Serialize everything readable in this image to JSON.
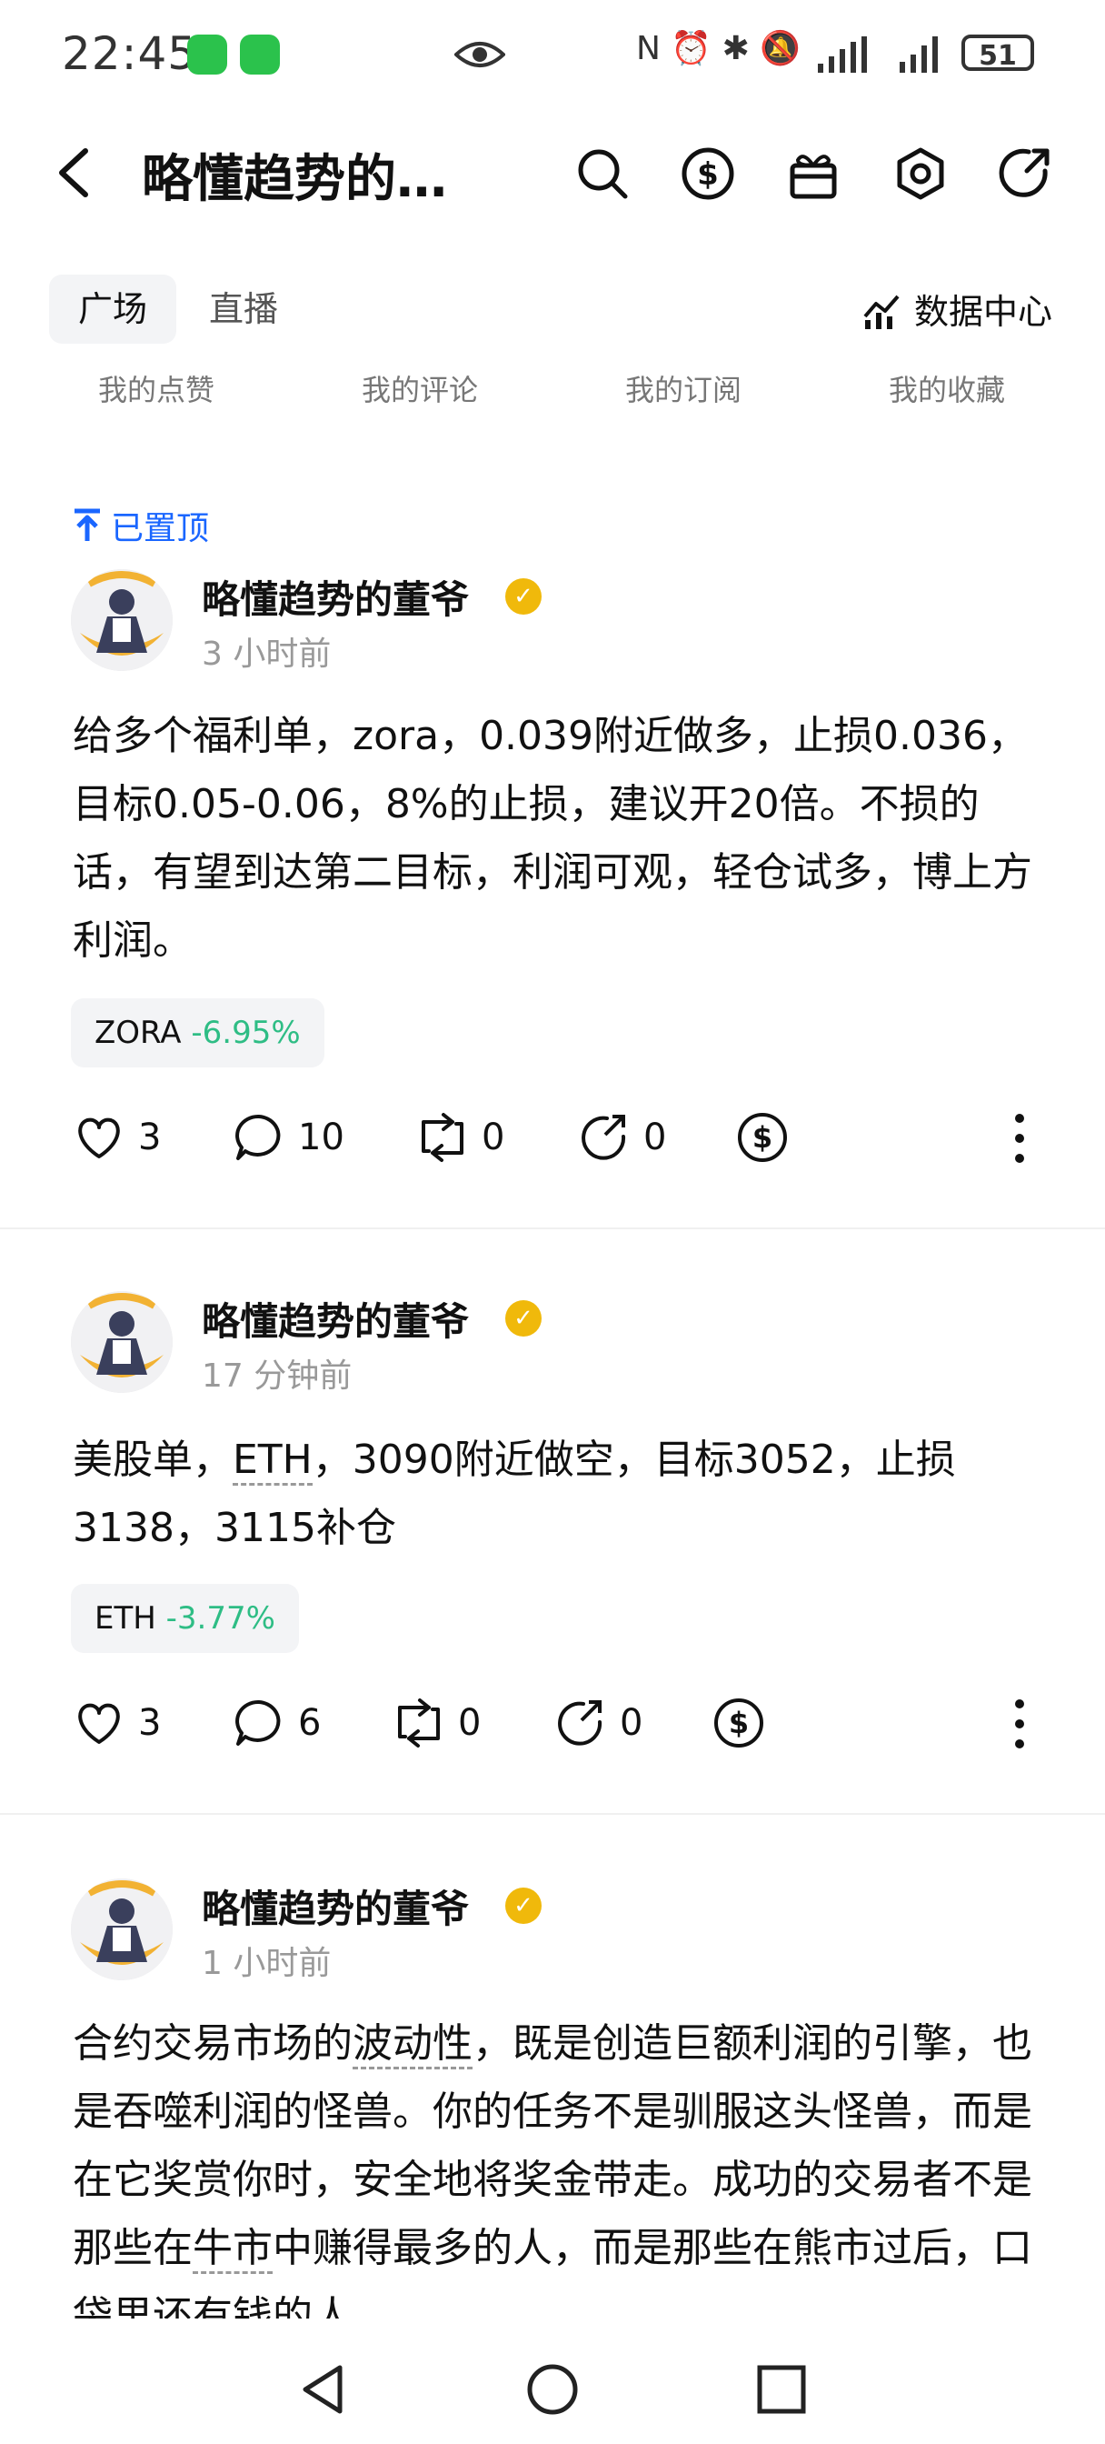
{
  "status_bar": {
    "time": "22:45",
    "signal_text": "N  ⏰  ✱  🔕",
    "battery": "51"
  },
  "header": {
    "title": "略懂趋势的…",
    "icons": [
      "search-icon",
      "dollar-icon",
      "gift-icon",
      "settings-icon",
      "share-icon"
    ]
  },
  "tabs": {
    "active": "广场",
    "other": "直播",
    "data_center": "数据中心"
  },
  "subtabs": [
    "我的点赞",
    "我的评论",
    "我的订阅",
    "我的收藏"
  ],
  "pinned_label": "已置顶",
  "posts": [
    {
      "author": "略懂趋势的董爷",
      "time": "3 小时前",
      "content": "给多个福利单，zora，0.039附近做多，止损0.036，目标0.05-0.06，8%的止损，建议开20倍。不损的话，有望到达第二目标，利润可观，轻仓试多，博上方利润。",
      "tag_symbol": "ZORA",
      "tag_change": "-6.95%",
      "likes": "3",
      "comments": "10",
      "reposts": "0",
      "shares": "0"
    },
    {
      "author": "略懂趋势的董爷",
      "time": "17 分钟前",
      "content_parts": [
        "美股单，",
        "ETH",
        "，3090附近做空，目标3052，止损3138，3115补仓"
      ],
      "tag_symbol": "ETH",
      "tag_change": "-3.77%",
      "likes": "3",
      "comments": "6",
      "reposts": "0",
      "shares": "0"
    },
    {
      "author": "略懂趋势的董爷",
      "time": "1 小时前",
      "content_parts": [
        "合约交易市场的",
        "波动性",
        "，既是创造巨额利润的引擎，也是吞噬利润的怪兽。你的任务不是驯服这头怪兽，而是在它奖赏你时，安全地将奖金带走。成功的交易者不是那些在",
        "牛市",
        "中赚得最多的人，而是那些在熊市过后，口袋里还有钱的人…"
      ]
    }
  ]
}
